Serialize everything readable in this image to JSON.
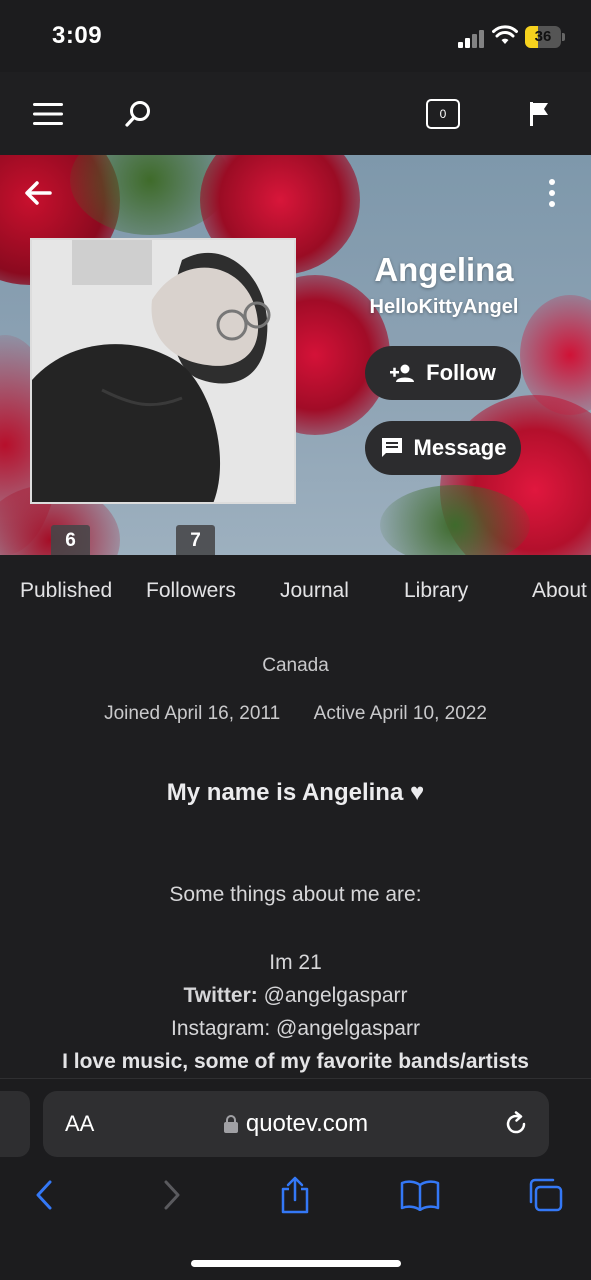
{
  "status_bar": {
    "time": "3:09",
    "battery_level": "36",
    "battery_color": "#f6d21e"
  },
  "header": {
    "notifications_count": "0"
  },
  "profile": {
    "name": "Angelina",
    "username": "HelloKittyAngel",
    "follow_label": "Follow",
    "message_label": "Message",
    "published_count": "6",
    "followers_count": "7"
  },
  "tabs": [
    "Published",
    "Followers",
    "Journal",
    "Library",
    "About"
  ],
  "details": {
    "location": "Canada",
    "joined": "Joined April 16, 2011",
    "active": "Active April 10, 2022"
  },
  "bio": {
    "headline": "My name is Angelina ♥",
    "intro": "Some things about me are:",
    "age": "Im 21",
    "twitter_label": "Twitter:",
    "twitter_handle": "@angelgasparr",
    "instagram": "Instagram: @angelgasparr",
    "music": "I love music, some of my favorite bands/artists"
  },
  "browser": {
    "text_size_label": "AA",
    "url": "quotev.com"
  },
  "colors": {
    "accent": "#3478f6",
    "background": "#1e1e20",
    "button": "#2c2c2e"
  },
  "icons": [
    "menu-icon",
    "search-icon",
    "notifications-icon",
    "flag-icon",
    "back-arrow-icon",
    "more-vertical-icon",
    "add-person-icon",
    "chat-icon",
    "lock-icon",
    "reload-icon",
    "browser-back-icon",
    "browser-forward-icon",
    "share-icon",
    "bookmarks-icon",
    "tabs-icon"
  ]
}
